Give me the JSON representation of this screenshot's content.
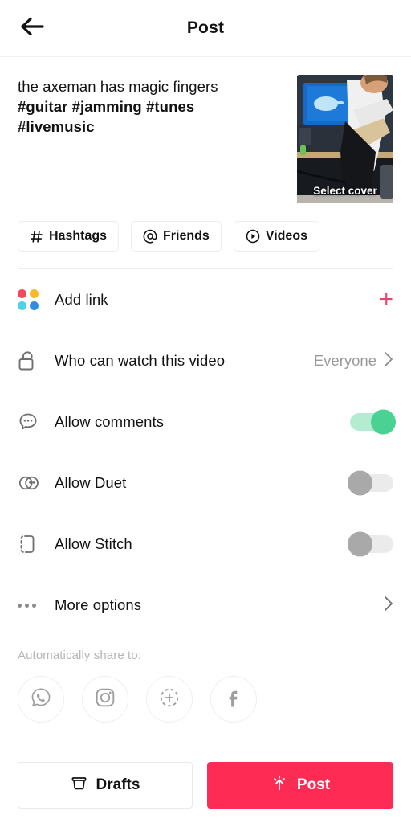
{
  "header": {
    "title": "Post",
    "back_icon": "back-arrow-icon"
  },
  "caption": {
    "line1": "the axeman has magic fingers",
    "line2": "#guitar #jamming #tunes",
    "line3": "#livemusic"
  },
  "cover": {
    "label": "Select cover",
    "alt": "guitarist playing electric guitar in a studio"
  },
  "chips": [
    {
      "label": "Hashtags",
      "icon": "hash-icon"
    },
    {
      "label": "Friends",
      "icon": "at-icon"
    },
    {
      "label": "Videos",
      "icon": "play-circle-icon"
    }
  ],
  "options": {
    "add_link": {
      "label": "Add link",
      "icon": "color-dots-icon",
      "action_icon": "plus-icon",
      "accent": "#e8446b"
    },
    "privacy": {
      "label": "Who can watch this video",
      "icon": "unlock-icon",
      "value": "Everyone",
      "action_icon": "chevron-right-icon"
    },
    "comments": {
      "label": "Allow comments",
      "icon": "comment-bubble-icon",
      "state": "on"
    },
    "duet": {
      "label": "Allow Duet",
      "icon": "duet-icon",
      "state": "off"
    },
    "stitch": {
      "label": "Allow Stitch",
      "icon": "stitch-icon",
      "state": "off"
    },
    "more": {
      "label": "More options",
      "icon": "ellipsis-icon",
      "action_icon": "chevron-right-icon"
    }
  },
  "share": {
    "title": "Automatically share to:",
    "targets": [
      {
        "name": "whatsapp",
        "icon": "whatsapp-icon"
      },
      {
        "name": "instagram",
        "icon": "instagram-icon"
      },
      {
        "name": "instagram-story",
        "icon": "instagram-story-icon"
      },
      {
        "name": "facebook",
        "icon": "facebook-icon"
      }
    ]
  },
  "bottom": {
    "drafts": {
      "label": "Drafts",
      "icon": "archive-box-icon"
    },
    "post": {
      "label": "Post",
      "icon": "upload-sparkle-icon",
      "color": "#fe2c55"
    }
  },
  "colors": {
    "accent_red": "#fe2c55",
    "toggle_on_track": "#b4ecd2",
    "toggle_on_knob": "#4ad295",
    "toggle_off_track": "#ebebeb",
    "toggle_off_knob": "#a9a9a9",
    "muted_text": "#9a9a9a",
    "link_dot_tl": "#f04a5f",
    "link_dot_tr": "#f7b928",
    "link_dot_bl": "#4fd2e8",
    "link_dot_br": "#2f8ee0"
  }
}
